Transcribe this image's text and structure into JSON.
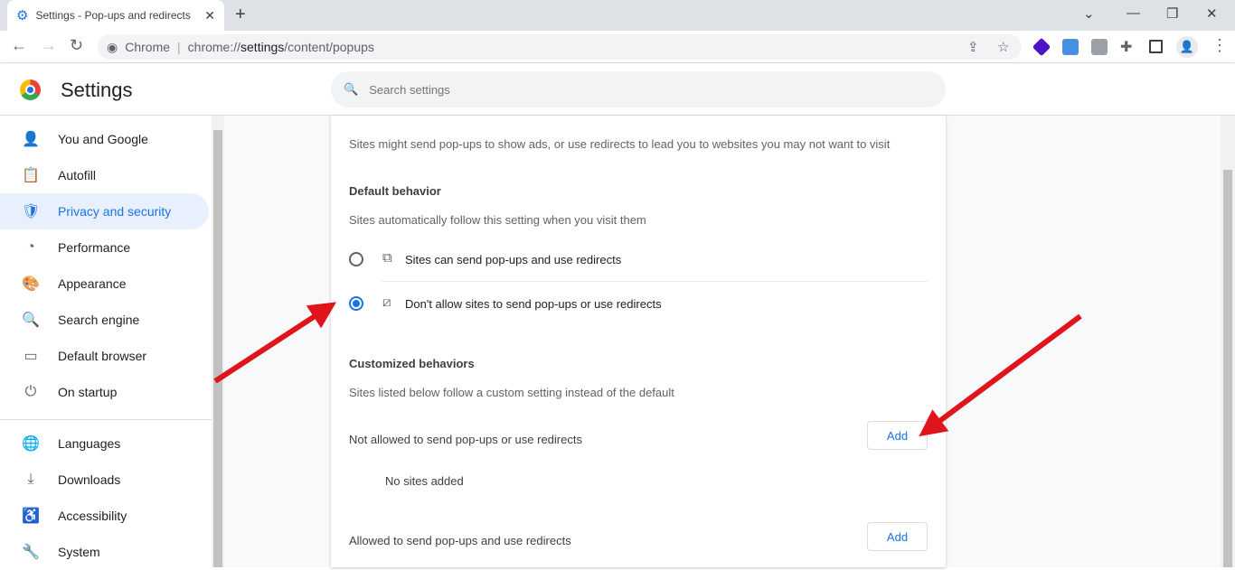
{
  "browser": {
    "tab_title": "Settings - Pop-ups and redirects",
    "omnibox_site": "Chrome",
    "url_prefix": "chrome://",
    "url_host": "settings",
    "url_path": "/content/popups"
  },
  "header": {
    "title": "Settings",
    "search_placeholder": "Search settings"
  },
  "sidebar": {
    "items": [
      {
        "label": "You and Google",
        "icon": "👤"
      },
      {
        "label": "Autofill",
        "icon": "📋"
      },
      {
        "label": "Privacy and security",
        "icon": "🛡",
        "active": true
      },
      {
        "label": "Performance",
        "icon": "◔"
      },
      {
        "label": "Appearance",
        "icon": "🎨"
      },
      {
        "label": "Search engine",
        "icon": "🔍"
      },
      {
        "label": "Default browser",
        "icon": "▭"
      },
      {
        "label": "On startup",
        "icon": "⏻"
      },
      {
        "label": "Languages",
        "icon": "🌐"
      },
      {
        "label": "Downloads",
        "icon": "⤓"
      },
      {
        "label": "Accessibility",
        "icon": "♿"
      },
      {
        "label": "System",
        "icon": "🔧"
      }
    ]
  },
  "content": {
    "description": "Sites might send pop-ups to show ads, or use redirects to lead you to websites you may not want to visit",
    "default_heading": "Default behavior",
    "default_sub": "Sites automatically follow this setting when you visit them",
    "option_allow": "Sites can send pop-ups and use redirects",
    "option_block": "Don't allow sites to send pop-ups or use redirects",
    "selected_option": "block",
    "custom_heading": "Customized behaviors",
    "custom_sub": "Sites listed below follow a custom setting instead of the default",
    "not_allowed_label": "Not allowed to send pop-ups or use redirects",
    "add_label": "Add",
    "no_sites": "No sites added",
    "allowed_label": "Allowed to send pop-ups and use redirects"
  },
  "colors": {
    "accent": "#1a73e8",
    "annotation_arrow": "#e0141b"
  }
}
